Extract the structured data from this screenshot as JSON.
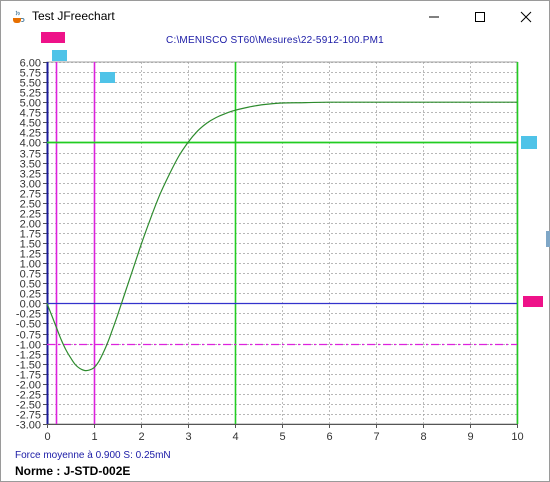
{
  "window": {
    "title": "Test JFreechart",
    "icon": "java-coffee-icon",
    "controls": [
      "minimize-icon",
      "maximize-icon",
      "close-icon"
    ]
  },
  "header": {
    "file_path": "C:\\MENISCO ST60\\Mesures\\22-5912-100.PM1"
  },
  "footer": {
    "force_text": "Force moyenne à 0.900 S: 0.25mN",
    "norme": "Norme : J-STD-002E"
  },
  "colors": {
    "curve": "#2e8b2e",
    "grid": "#a0a0a0",
    "magenta_marker": "#ee1289",
    "cyan_marker": "#4fc3e8",
    "green_line": "#22cc22",
    "blue_line": "#3333cc",
    "magenta_line": "#dd22dd"
  },
  "chart_data": {
    "type": "line",
    "x_ticks": [
      "0",
      "1",
      "2",
      "3",
      "4",
      "5",
      "6",
      "7",
      "8",
      "9",
      "10"
    ],
    "y_ticks": [
      "-3.00",
      "-2.75",
      "-2.50",
      "-2.25",
      "-2.00",
      "-1.75",
      "-1.50",
      "-1.25",
      "-1.00",
      "-0.75",
      "-0.50",
      "-0.25",
      "0.00",
      "0.25",
      "0.50",
      "0.75",
      "1.00",
      "1.25",
      "1.50",
      "1.75",
      "2.00",
      "2.25",
      "2.50",
      "2.75",
      "3.00",
      "3.25",
      "3.50",
      "3.75",
      "4.00",
      "4.25",
      "4.50",
      "4.75",
      "5.00",
      "5.25",
      "5.50",
      "5.75",
      "6.00"
    ],
    "xlim": [
      0,
      10
    ],
    "ylim": [
      -3,
      6
    ],
    "grid": true,
    "series": [
      {
        "x": [
          0,
          0.1,
          0.2,
          0.3,
          0.4,
          0.5,
          0.6,
          0.7,
          0.8,
          0.9,
          1.0,
          1.1,
          1.2,
          1.3,
          1.4,
          1.5,
          1.6,
          1.7,
          1.8,
          1.9,
          2.0,
          2.2,
          2.4,
          2.6,
          2.8,
          3.0,
          3.2,
          3.4,
          3.6,
          3.8,
          4.0,
          4.3,
          4.6,
          5.0,
          5.5,
          6.0,
          7.0,
          8.0,
          9.0,
          10.0
        ],
        "y": [
          0.0,
          -0.3,
          -0.6,
          -0.9,
          -1.15,
          -1.35,
          -1.52,
          -1.62,
          -1.67,
          -1.66,
          -1.6,
          -1.45,
          -1.22,
          -0.95,
          -0.63,
          -0.3,
          0.05,
          0.4,
          0.75,
          1.1,
          1.45,
          2.1,
          2.7,
          3.2,
          3.65,
          4.0,
          4.28,
          4.48,
          4.62,
          4.72,
          4.8,
          4.88,
          4.94,
          4.98,
          4.99,
          5.0,
          5.0,
          5.0,
          5.0,
          5.0
        ]
      }
    ],
    "vertical_lines": [
      {
        "x": 0.2,
        "color": "magenta"
      },
      {
        "x": 1.0,
        "color": "magenta"
      },
      {
        "x": 4.0,
        "color": "green"
      },
      {
        "x": 10.0,
        "color": "green"
      }
    ],
    "horizontal_lines": [
      {
        "y": 4.0,
        "color": "green"
      },
      {
        "y": 0.0,
        "color": "blue"
      },
      {
        "y": -1.0,
        "color": "magenta-dashed"
      }
    ]
  }
}
